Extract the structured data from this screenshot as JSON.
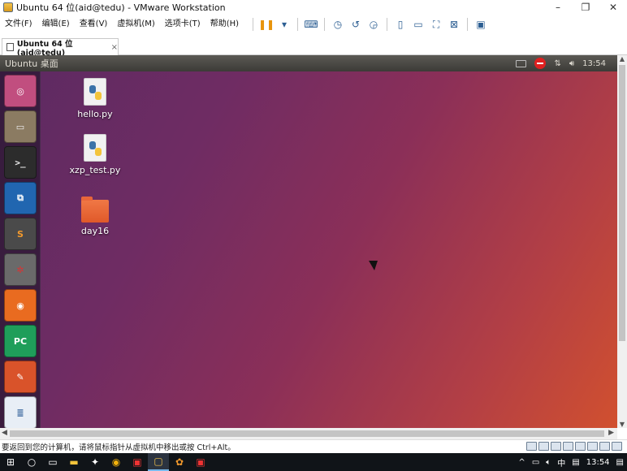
{
  "window": {
    "title": "Ubuntu 64 位(aid@tedu) - VMware Workstation",
    "controls": {
      "minimize": "–",
      "maximize": "❐",
      "close": "✕"
    }
  },
  "menu": {
    "items": [
      "文件(F)",
      "编辑(E)",
      "查看(V)",
      "虚拟机(M)",
      "选项卡(T)",
      "帮助(H)"
    ]
  },
  "toolbar": {
    "icons": [
      "pause-icon",
      "dropdown-icon",
      "send-keys-icon",
      "snapshot-icon",
      "revert-snapshot-icon",
      "snapshot-manager-icon",
      "library-icon",
      "console-view-icon",
      "fullscreen-icon",
      "unity-icon",
      "thumbnail-icon"
    ]
  },
  "tab": {
    "label": "Ubuntu 64 位(aid@tedu)",
    "close": "×"
  },
  "ubuntu": {
    "topbar_title": "Ubuntu 桌面",
    "clock": "13:54"
  },
  "launcher": {
    "items": [
      {
        "name": "dash-home",
        "color": "#c14e7f"
      },
      {
        "name": "files",
        "color": "#8b7b62"
      },
      {
        "name": "terminal",
        "color": "#2c2c2c"
      },
      {
        "name": "vscode",
        "color": "#2166b0"
      },
      {
        "name": "sublime-text",
        "color": "#4a4a4a"
      },
      {
        "name": "network-tool",
        "color": "#6a6a6a"
      },
      {
        "name": "firefox",
        "color": "#e96b20"
      },
      {
        "name": "pycharm",
        "color": "#1f9e5a"
      },
      {
        "name": "editor",
        "color": "#d9532a"
      },
      {
        "name": "libreoffice-writer",
        "color": "#e8eef6"
      }
    ]
  },
  "desktop": {
    "icons": [
      {
        "label": "hello.py",
        "kind": "python-file"
      },
      {
        "label": "xzp_test.py",
        "kind": "python-file"
      },
      {
        "label": "day16",
        "kind": "folder"
      }
    ]
  },
  "status": {
    "message": "要返回到您的计算机，请将鼠标指针从虚拟机中移出或按 Ctrl+Alt。"
  },
  "taskbar": {
    "tray_text": [
      "^",
      "中",
      "13:54"
    ]
  }
}
